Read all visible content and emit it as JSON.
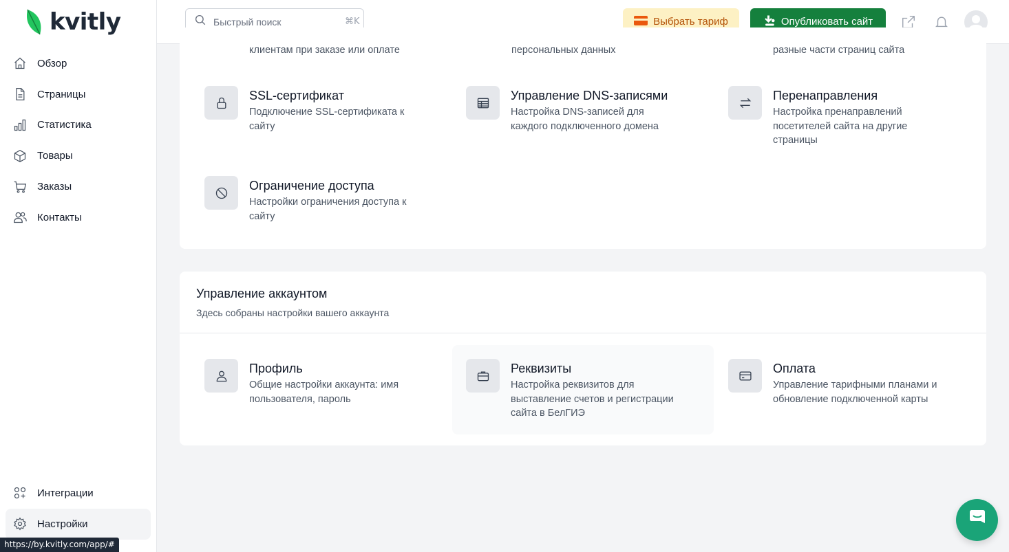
{
  "brand": {
    "name": "kvitly",
    "color": "#22c55e"
  },
  "sidebar": {
    "items": [
      {
        "label": "Обзор",
        "icon": "home-icon"
      },
      {
        "label": "Страницы",
        "icon": "file-icon"
      },
      {
        "label": "Статистика",
        "icon": "bar-chart-icon"
      },
      {
        "label": "Товары",
        "icon": "box-icon"
      },
      {
        "label": "Заказы",
        "icon": "cart-icon"
      },
      {
        "label": "Контакты",
        "icon": "users-icon"
      }
    ],
    "bottom": [
      {
        "label": "Интеграции",
        "icon": "grid-plus-icon"
      },
      {
        "label": "Настройки",
        "icon": "gear-icon",
        "active": true
      }
    ]
  },
  "header": {
    "search_placeholder": "Быстрый поиск",
    "search_shortcut": "⌘K",
    "tariff_label": "Выбрать тариф",
    "publish_label": "Опубликовать сайт"
  },
  "top_section": {
    "cut_texts": [
      "клиентам при заказе или оплате",
      "персональных данных",
      "разные части страниц сайта"
    ],
    "tiles": [
      {
        "title": "SSL-сертификат",
        "desc": "Подключение SSL-сертификата к сайту",
        "icon": "lock-icon"
      },
      {
        "title": "Управление DNS-записями",
        "desc": "Настройка DNS-записей для каждого подключенного домена",
        "icon": "table-icon"
      },
      {
        "title": "Перенаправления",
        "desc": "Настройка пренаправлений посетителей сайта на другие страницы",
        "icon": "arrows-swap-icon"
      },
      {
        "title": "Ограничение доступа",
        "desc": "Настройки ограничения доступа к сайту",
        "icon": "ban-icon"
      }
    ]
  },
  "account": {
    "title": "Управление аккаунтом",
    "subtitle": "Здесь собраны настройки вашего аккаунта",
    "tiles": [
      {
        "title": "Профиль",
        "desc": "Общие настройки аккаунта: имя пользователя, пароль",
        "icon": "user-icon"
      },
      {
        "title": "Реквизиты",
        "desc": "Настройка реквизитов для выставление счетов и регистрации сайта в БелГИЭ",
        "icon": "briefcase-icon"
      },
      {
        "title": "Оплата",
        "desc": "Управление тарифными планами и обновление подключенной карты",
        "icon": "credit-card-icon"
      }
    ]
  },
  "status_url": "https://by.kvitly.com/app/#"
}
